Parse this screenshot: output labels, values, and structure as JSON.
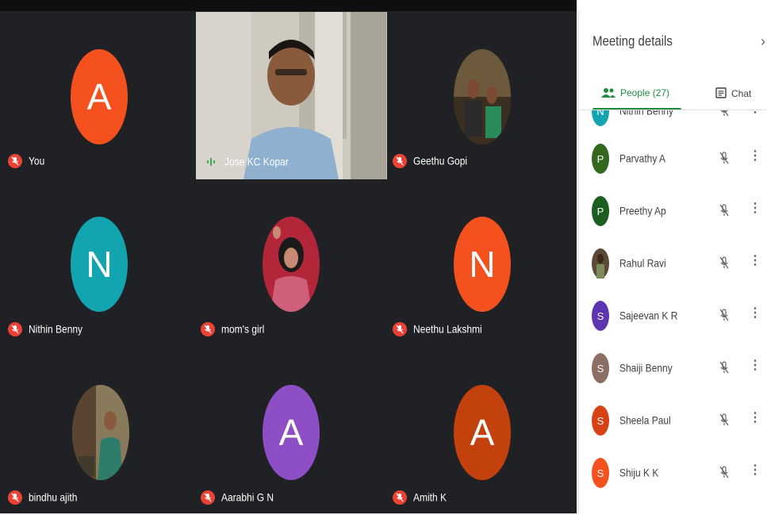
{
  "panel": {
    "title": "Meeting details",
    "tabs": [
      {
        "label": "People (27)",
        "active": true
      },
      {
        "label": "Chat",
        "active": false
      }
    ],
    "people": [
      {
        "name": "Nithin Benny",
        "initial": "N",
        "color": "#12a4af"
      },
      {
        "name": "Parvathy A",
        "initial": "P",
        "color": "#33691e"
      },
      {
        "name": "Preethy Ap",
        "initial": "P",
        "color": "#1b5e20"
      },
      {
        "name": "Rahul Ravi",
        "initial": "",
        "color": "#5d4a36",
        "photo": true
      },
      {
        "name": "Sajeevan K R",
        "initial": "S",
        "color": "#5e35b1"
      },
      {
        "name": "Shaiji Benny",
        "initial": "S",
        "color": "#8d6e63"
      },
      {
        "name": "Sheela Paul",
        "initial": "S",
        "color": "#d84315"
      },
      {
        "name": "Shiju K K",
        "initial": "S",
        "color": "#f4511e"
      }
    ]
  },
  "tiles": [
    {
      "name": "You",
      "initial": "A",
      "color": "#f4511e",
      "muted": true
    },
    {
      "name": "Jose KC Kopar",
      "video": true,
      "speaking": true
    },
    {
      "name": "Geethu Gopi",
      "photo": true,
      "muted": true
    },
    {
      "name": "Nithin Benny",
      "initial": "N",
      "color": "#12a4af",
      "muted": true
    },
    {
      "name": "mom's girl",
      "photo": true,
      "muted": true
    },
    {
      "name": "Neethu Lakshmi",
      "initial": "N",
      "color": "#f4511e",
      "muted": true
    },
    {
      "name": "bindhu ajith",
      "photo": true,
      "muted": true
    },
    {
      "name": "Aarabhi G N",
      "initial": "A",
      "color": "#8e4ec6",
      "muted": true
    },
    {
      "name": "Amith K",
      "initial": "A",
      "color": "#c2410c",
      "muted": true
    }
  ],
  "icons": {
    "mic_off": "mic-off-icon",
    "speaking": "audio-level-icon",
    "people": "people-icon",
    "chat": "chat-icon",
    "close": "close-icon",
    "more": "more-vert-icon"
  }
}
